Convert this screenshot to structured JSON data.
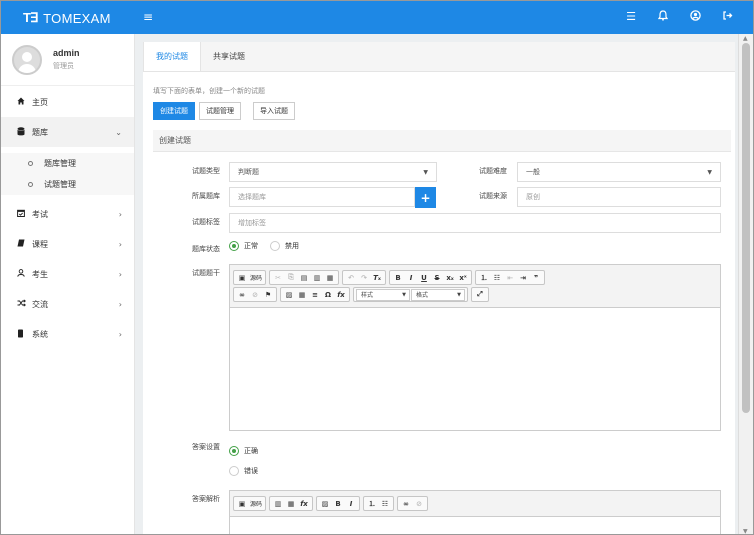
{
  "app": {
    "logo_mark": "T∃",
    "title": "TOMEXAM"
  },
  "topbar": {
    "menu_icon": "menu-icon",
    "icons": [
      "list-icon",
      "bell-icon",
      "user-circle-icon",
      "logout-icon"
    ]
  },
  "user": {
    "name": "admin",
    "role": "管理员"
  },
  "sidebar": {
    "home": "主页",
    "bank": "题库",
    "bank_sub": [
      "题库管理",
      "试题管理"
    ],
    "items": [
      "考试",
      "课程",
      "考生",
      "交流",
      "系统"
    ]
  },
  "tabs": [
    "我的试题",
    "共享试题"
  ],
  "hint": "填写下面的表单，创建一个新的试题",
  "buttons": {
    "create": "创建试题",
    "manage": "试题管理",
    "import": "导入试题"
  },
  "section_title": "创建试题",
  "form": {
    "type_label": "试题类型",
    "type_value": "判断题",
    "difficulty_label": "试题难度",
    "difficulty_value": "一般",
    "bank_label": "所属题库",
    "bank_placeholder": "选择题库",
    "source_label": "试题来源",
    "source_placeholder": "原创",
    "tag_label": "试题标签",
    "tag_placeholder": "增加标签",
    "status_label": "题库状态",
    "status_on": "正常",
    "status_off": "禁用",
    "stem_label": "试题题干",
    "answer_label": "答案设置",
    "answer_true": "正确",
    "answer_false": "错误",
    "analysis_label": "答案解析"
  },
  "editor": {
    "source": "源码",
    "style_combo": "样式",
    "format_combo": "格式"
  },
  "colors": {
    "primary": "#1e88e5",
    "radio_on": "#43a047"
  }
}
